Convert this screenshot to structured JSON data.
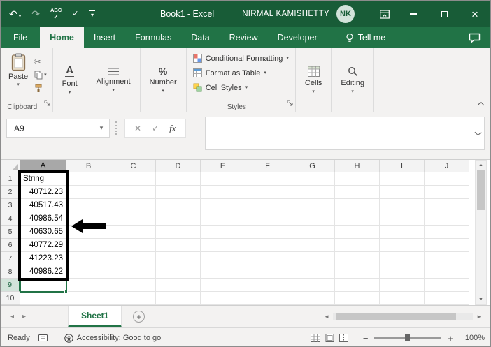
{
  "titlebar": {
    "title": "Book1 -  Excel",
    "user_name": "NIRMAL KAMISHETTY",
    "user_initials": "NK"
  },
  "tab_bar": {
    "tabs": [
      {
        "label": "File"
      },
      {
        "label": "Home"
      },
      {
        "label": "Insert"
      },
      {
        "label": "Formulas"
      },
      {
        "label": "Data"
      },
      {
        "label": "Review"
      },
      {
        "label": "Developer"
      }
    ],
    "tell_me_label": "Tell me"
  },
  "ribbon": {
    "paste_label": "Paste",
    "clipboard_group_label": "Clipboard",
    "font_label": "Font",
    "alignment_label": "Alignment",
    "number_label": "Number",
    "conditional_formatting_label": "Conditional Formatting",
    "format_as_table_label": "Format as Table",
    "cell_styles_label": "Cell Styles",
    "styles_group_label": "Styles",
    "cells_label": "Cells",
    "editing_label": "Editing"
  },
  "formula_bar": {
    "name_box_value": "A9",
    "formula_value": ""
  },
  "grid": {
    "column_headers": [
      "A",
      "B",
      "C",
      "D",
      "E",
      "F",
      "G",
      "H",
      "I",
      "J"
    ],
    "row_headers": [
      "1",
      "2",
      "3",
      "4",
      "5",
      "6",
      "7",
      "8",
      "9",
      "10"
    ],
    "column_a_values": [
      "String",
      "40712.23",
      "40517.43",
      "40986.54",
      "40630.65",
      "40772.29",
      "41223.23",
      "40986.22"
    ],
    "selected_cell": "A9"
  },
  "sheet_bar": {
    "active_sheet": "Sheet1"
  },
  "status_bar": {
    "mode": "Ready",
    "accessibility": "Accessibility: Good to go",
    "zoom_level": "100%"
  },
  "icons": {
    "undo": "↶",
    "redo": "↷",
    "spelling_abc": "ABC",
    "check": "✓",
    "caret_down": "▾",
    "cut": "✂",
    "cancel": "✕",
    "fx": "fx",
    "percent": "%",
    "font_a": "A",
    "close": "×",
    "scroll_up": "▲",
    "scroll_down": "▼",
    "scroll_left": "◄",
    "scroll_right": "►",
    "nav_left": "◂",
    "nav_right": "▸",
    "add_sheet": "+",
    "zoom_out": "−",
    "zoom_in": "+"
  },
  "colors": {
    "title_green": "#185c37",
    "ribbon_green": "#217346",
    "accent_green": "#217346"
  }
}
